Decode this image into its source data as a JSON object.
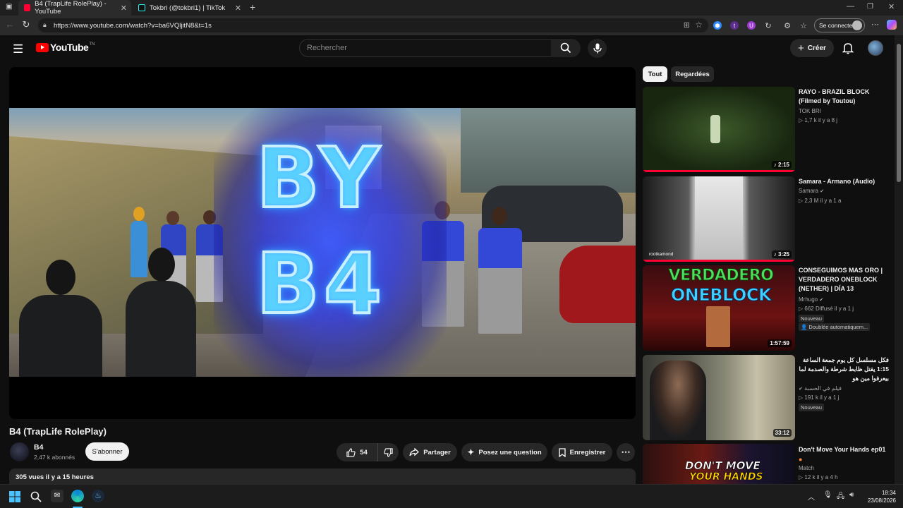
{
  "browser": {
    "tabs": [
      {
        "title": "B4 (TrapLife RolePlay) - YouTube",
        "active": true
      },
      {
        "title": "Tokbri (@tokbri1) | TikTok",
        "active": false
      }
    ],
    "new_tab": "+",
    "url": "https://www.youtube.com/watch?v=ba6VQljitN8&t=1s",
    "signin_label": "Se connecter"
  },
  "youtube": {
    "logo_text": "YouTube",
    "country_code": "TN",
    "search_placeholder": "Rechercher",
    "create_label": "Créer"
  },
  "player": {
    "overlay_line1": "BY",
    "overlay_line2": "B4"
  },
  "video": {
    "title": "B4 (TrapLife RolePlay)",
    "channel": "B4",
    "subscribers": "2,47 k abonnés",
    "subscribe_label": "S'abonner",
    "likes": "54",
    "share_label": "Partager",
    "ask_label": "Posez une question",
    "save_label": "Enregistrer",
    "views_meta": "305 vues  il y a 15 heures"
  },
  "sidebar": {
    "chips": [
      "Tout",
      "Regardées"
    ],
    "items": [
      {
        "title": "RAYO - BRAZIL BLOCK (Filmed by Toutou)",
        "channel": "TOK BRI",
        "meta": "▷ 1,7 k   il y a 8 j",
        "duration": "♪ 2:15",
        "progress": 1.0
      },
      {
        "title": "Samara - Armano (Audio)",
        "channel": "Samara",
        "meta": "▷ 2,3 M   il y a 1 a",
        "duration": "♪ 3:25",
        "progress": 1.0,
        "thumb_label": "rootkamond"
      },
      {
        "title": "CONSEGUIMOS MAS ORO | VERDADERO ONEBLOCK (NETHER) | DÍA 13",
        "channel": "Mrhugo",
        "meta": "▷ 662   Diffusé il y a 1 j",
        "badge1": "Nouveau",
        "badge2": "👤 Doublée automatiquem...",
        "duration": "1:57:59",
        "thumb_text1": "VERDADERO",
        "thumb_text2": "ONEBLOCK"
      },
      {
        "title": "فكل مسلسل كل يوم جمعة الساعة 1:15 يقتل ظابط شرطة والصدمة لما بيعرفوا مين هو",
        "channel": "فيلم في الحسبة",
        "meta": "▷ 191 k   il y a 1 j",
        "badge1": "Nouveau",
        "duration": "33:12"
      },
      {
        "title": "Don't Move Your Hands ep01",
        "channel": "Match",
        "meta": "▷ 12 k   il y a 4 h",
        "thumb_text1": "DON'T MOVE",
        "thumb_text2": "YOUR HANDS"
      }
    ]
  },
  "taskbar": {
    "time": "18:34",
    "date": "23/08/2026"
  }
}
